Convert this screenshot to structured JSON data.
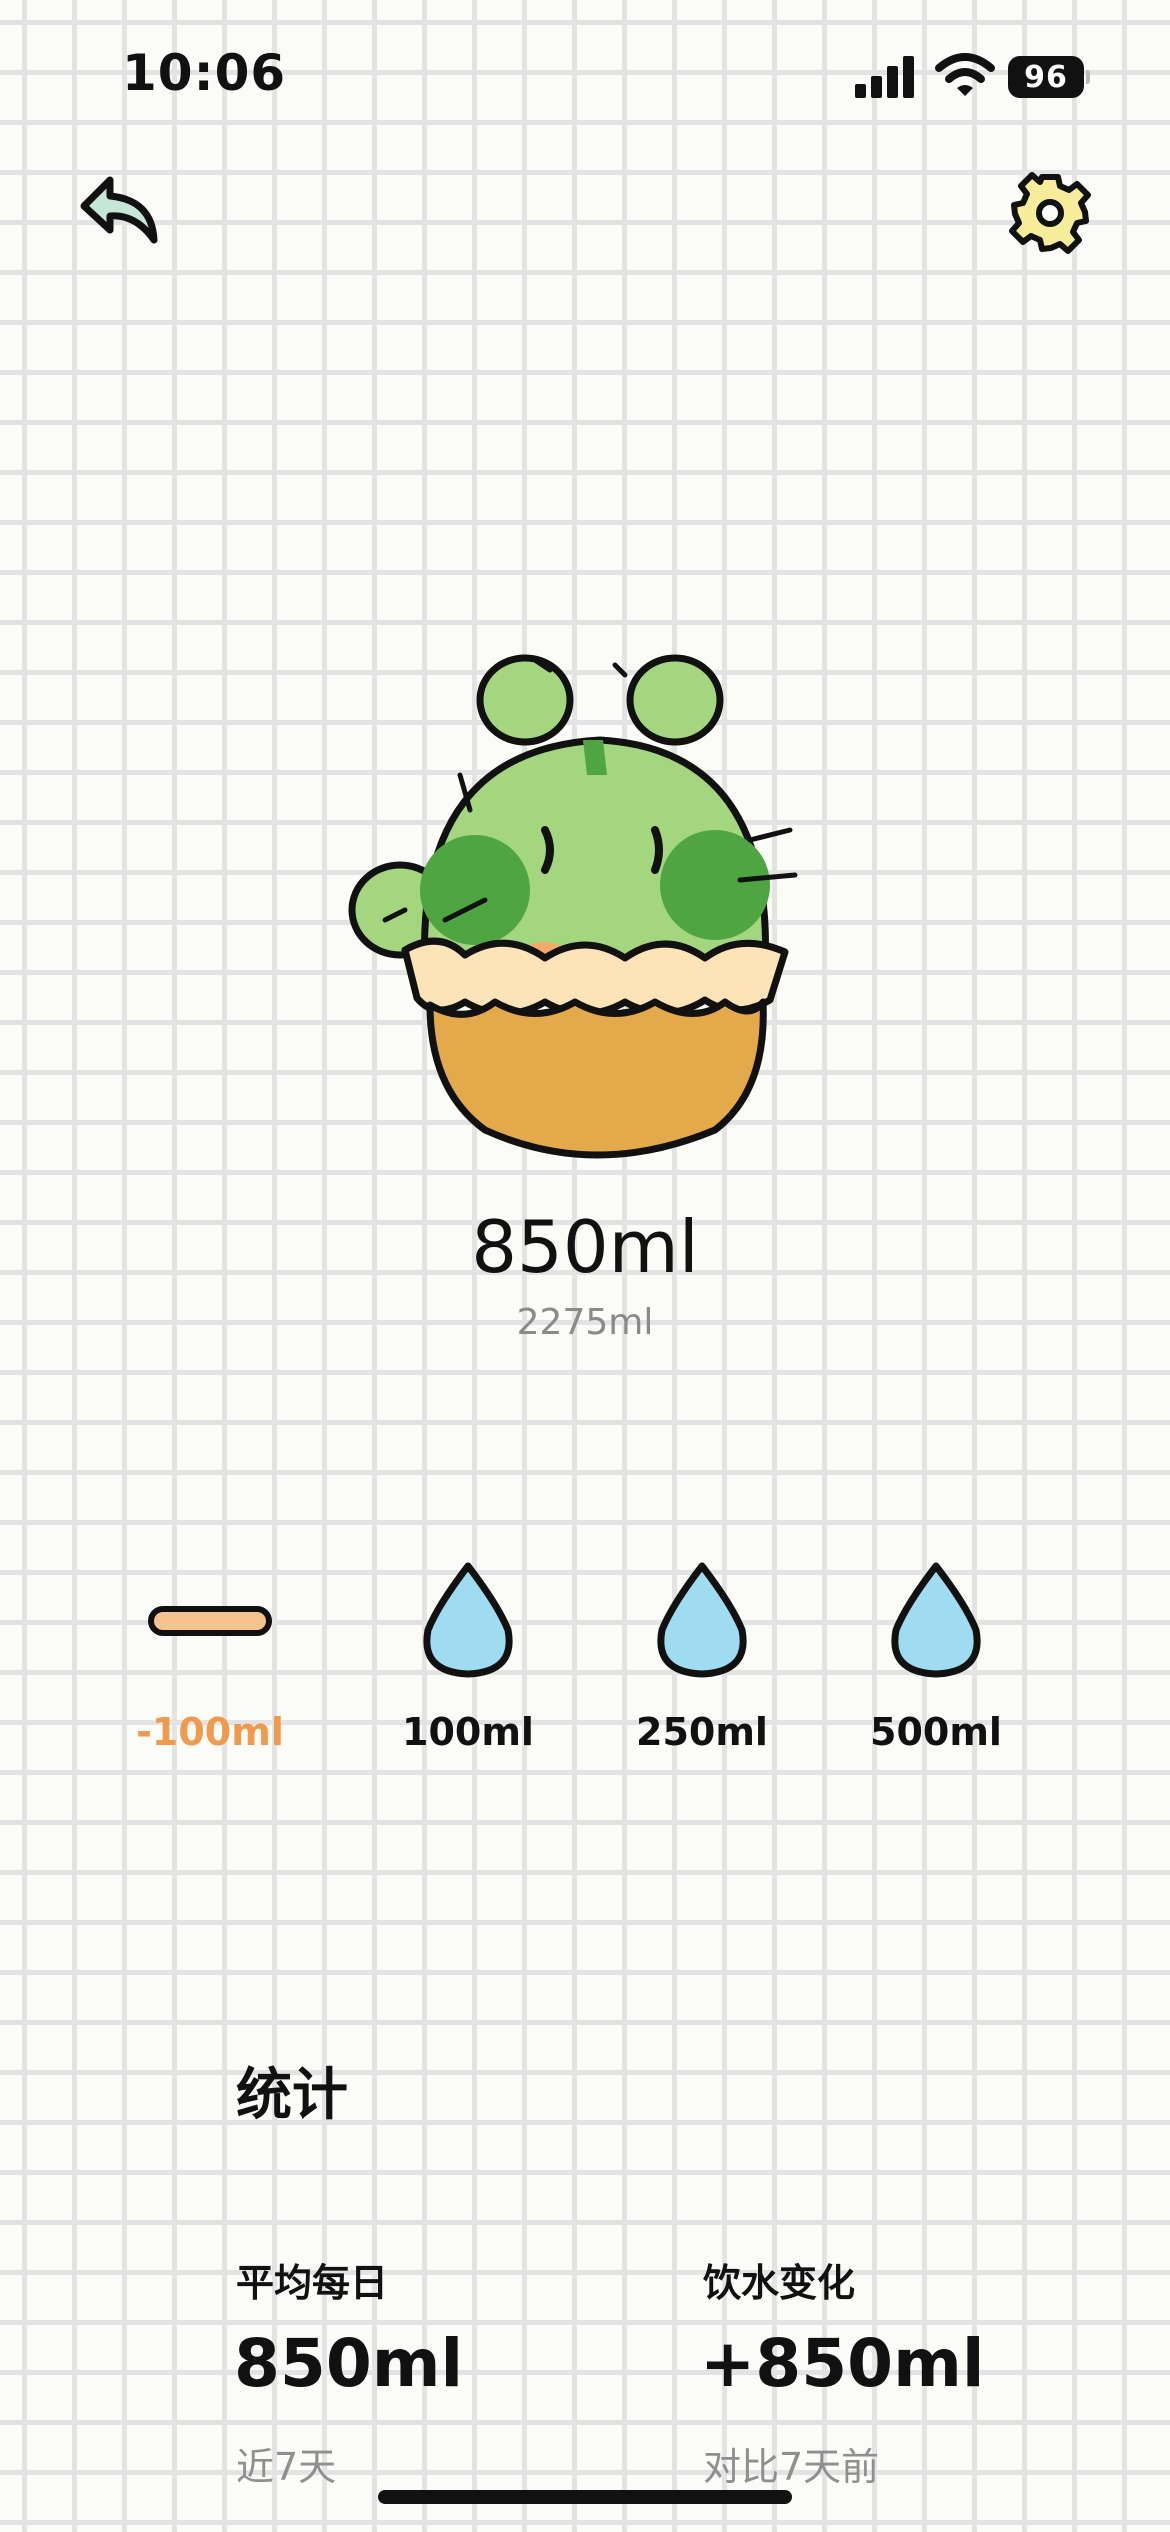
{
  "status_bar": {
    "time": "10:06",
    "battery": "96",
    "icons": [
      "cellular-signal-icon",
      "wifi-icon",
      "battery-icon"
    ]
  },
  "header": {
    "back_icon": "back-arrow-icon",
    "settings_icon": "gear-icon"
  },
  "mascot": {
    "name": "cactus-cupcake-mascot"
  },
  "intake": {
    "current": "850ml",
    "goal": "2275ml"
  },
  "quick_add": [
    {
      "label": "-100ml",
      "icon": "minus-icon",
      "color": "#ef9a4c"
    },
    {
      "label": "100ml",
      "icon": "water-drop-icon"
    },
    {
      "label": "250ml",
      "icon": "water-drop-icon"
    },
    {
      "label": "500ml",
      "icon": "water-drop-icon"
    }
  ],
  "stats": {
    "title": "统计",
    "average": {
      "label": "平均每日",
      "value": "850ml",
      "note": "近7天"
    },
    "change": {
      "label": "饮水变化",
      "value": "+850ml",
      "note": "对比7天前"
    }
  },
  "colors": {
    "drop_fill": "#9fdcf2",
    "minus_fill": "#f4c38e",
    "cactus_light": "#a3d67f",
    "cactus_dark": "#4fa541",
    "pot": "#e3a94a",
    "frill": "#fde3b8",
    "accent": "#ef9a4c"
  }
}
